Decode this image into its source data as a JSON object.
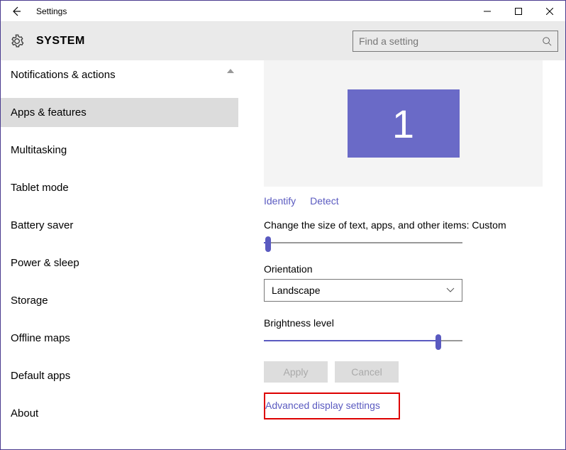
{
  "window": {
    "title": "Settings"
  },
  "header": {
    "page_title": "SYSTEM",
    "search_placeholder": "Find a setting"
  },
  "sidebar": {
    "items": [
      {
        "label": "Notifications & actions",
        "selected": false
      },
      {
        "label": "Apps & features",
        "selected": true
      },
      {
        "label": "Multitasking",
        "selected": false
      },
      {
        "label": "Tablet mode",
        "selected": false
      },
      {
        "label": "Battery saver",
        "selected": false
      },
      {
        "label": "Power & sleep",
        "selected": false
      },
      {
        "label": "Storage",
        "selected": false
      },
      {
        "label": "Offline maps",
        "selected": false
      },
      {
        "label": "Default apps",
        "selected": false
      },
      {
        "label": "About",
        "selected": false
      }
    ]
  },
  "main": {
    "monitor_number": "1",
    "identify_label": "Identify",
    "detect_label": "Detect",
    "scale_label": "Change the size of text, apps, and other items: Custom",
    "scale_slider_percent": 2,
    "orientation_label": "Orientation",
    "orientation_value": "Landscape",
    "brightness_label": "Brightness level",
    "brightness_slider_percent": 88,
    "apply_label": "Apply",
    "cancel_label": "Cancel",
    "advanced_link": "Advanced display settings"
  },
  "colors": {
    "accent": "#5a5ac0",
    "monitor": "#6a6ac7",
    "highlight": "#d00000"
  }
}
